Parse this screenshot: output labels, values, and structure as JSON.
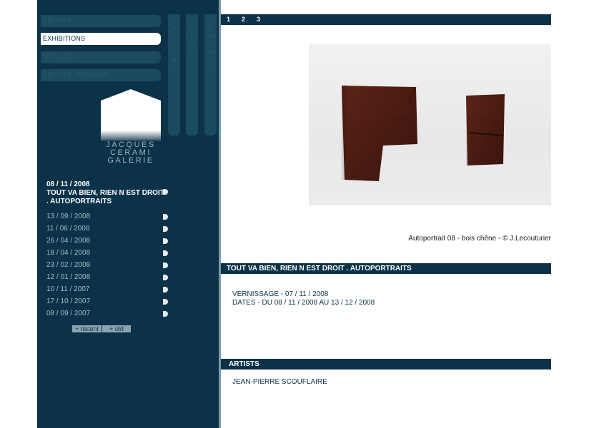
{
  "nav": {
    "items": [
      {
        "label": "ARTISTS"
      },
      {
        "label": "EXHIBITIONS"
      },
      {
        "label": "MEDIUMS"
      },
      {
        "label": "ARTISTS' PROGRAM"
      }
    ],
    "vertical_tabs": [
      "GALLERY",
      "INFOS",
      "CONTACT"
    ]
  },
  "logo": {
    "line1": "JACQUES",
    "line2": "CERAMI",
    "line3": "GALERIE"
  },
  "current_exhibition": {
    "date": "08 / 11 / 2008",
    "title": "TOUT VA BIEN, RIEN N EST DROIT . AUTOPORTRAITS"
  },
  "past_exhibitions": [
    "13 / 09 / 2008",
    "11 / 06 / 2008",
    "26 / 04 / 2008",
    "18 / 04 / 2008",
    "23 / 02 / 2008",
    "12 / 01 / 2008",
    "10 / 11 / 2007",
    "17 / 10 / 2007",
    "08 / 09 / 2007"
  ],
  "pager": {
    "recent_label": "+ recent",
    "old_label": "+ old"
  },
  "image_pages": [
    "1",
    "2",
    "3"
  ],
  "photo": {
    "caption": "Autoportrait 08 - bois chêne - © J.Lecouturier"
  },
  "exhibition": {
    "title": "TOUT VA BIEN, RIEN N EST DROIT . AUTOPORTRAITS",
    "vernissage": "VERNISSAGE - 07 / 11 / 2008",
    "dates": "DATES - DU 08 / 11 / 2008 AU 13 / 12 / 2008"
  },
  "artists_section": {
    "title": "ARTISTS",
    "names": [
      "JEAN-PIERRE SCOUFLAIRE"
    ]
  },
  "colors": {
    "sidebar": "#0b3248",
    "accent": "#1b4a61",
    "text_light": "#a8bcc7"
  }
}
